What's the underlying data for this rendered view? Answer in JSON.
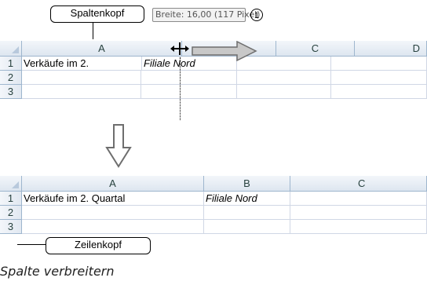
{
  "callouts": {
    "spaltenkopf": "Spaltenkopf",
    "zeilenkopf": "Zeilenkopf",
    "number_marker": "1"
  },
  "tooltip": {
    "text": "Breite: 16,00 (117 Pixel)"
  },
  "top_grid": {
    "columns": [
      "A",
      "C",
      "D"
    ],
    "rows": [
      "1",
      "2",
      "3"
    ],
    "cells": {
      "A1": "Verkäufe im 2.",
      "B1": "Filiale Nord"
    }
  },
  "bottom_grid": {
    "columns": [
      "A",
      "B",
      "C"
    ],
    "rows": [
      "1",
      "2",
      "3"
    ],
    "cells": {
      "A1": "Verkäufe im 2. Quartal",
      "B1": "Filiale Nord"
    }
  },
  "caption": "Spalte verbreitern",
  "colors": {
    "header_border": "#9eb6ce",
    "gridline": "#d0d7e5",
    "arrow_fill": "#c8c8c8",
    "arrow_stroke": "#6e6e6e"
  }
}
